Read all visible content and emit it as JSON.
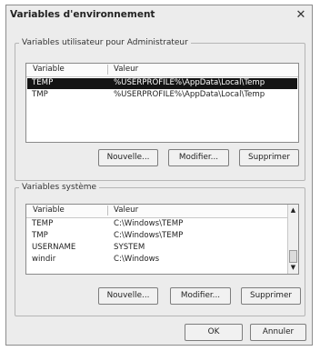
{
  "window": {
    "title": "Variables d'environnement",
    "close_glyph": "✕"
  },
  "user_vars": {
    "legend": "Variables utilisateur pour Administrateur",
    "col_variable": "Variable",
    "col_value": "Valeur",
    "rows": [
      {
        "name": "TEMP",
        "value": "%USERPROFILE%\\AppData\\Local\\Temp",
        "selected": true
      },
      {
        "name": "TMP",
        "value": "%USERPROFILE%\\AppData\\Local\\Temp",
        "selected": false
      }
    ],
    "btn_new": "Nouvelle...",
    "btn_edit": "Modifier...",
    "btn_delete": "Supprimer"
  },
  "sys_vars": {
    "legend": "Variables système",
    "col_variable": "Variable",
    "col_value": "Valeur",
    "rows": [
      {
        "name": "TEMP",
        "value": "C:\\Windows\\TEMP"
      },
      {
        "name": "TMP",
        "value": "C:\\Windows\\TEMP"
      },
      {
        "name": "USERNAME",
        "value": "SYSTEM"
      },
      {
        "name": "windir",
        "value": "C:\\Windows"
      }
    ],
    "btn_new": "Nouvelle...",
    "btn_edit": "Modifier...",
    "btn_delete": "Supprimer",
    "scroll_up_glyph": "▲",
    "scroll_down_glyph": "▼"
  },
  "footer": {
    "ok": "OK",
    "cancel": "Annuler"
  }
}
